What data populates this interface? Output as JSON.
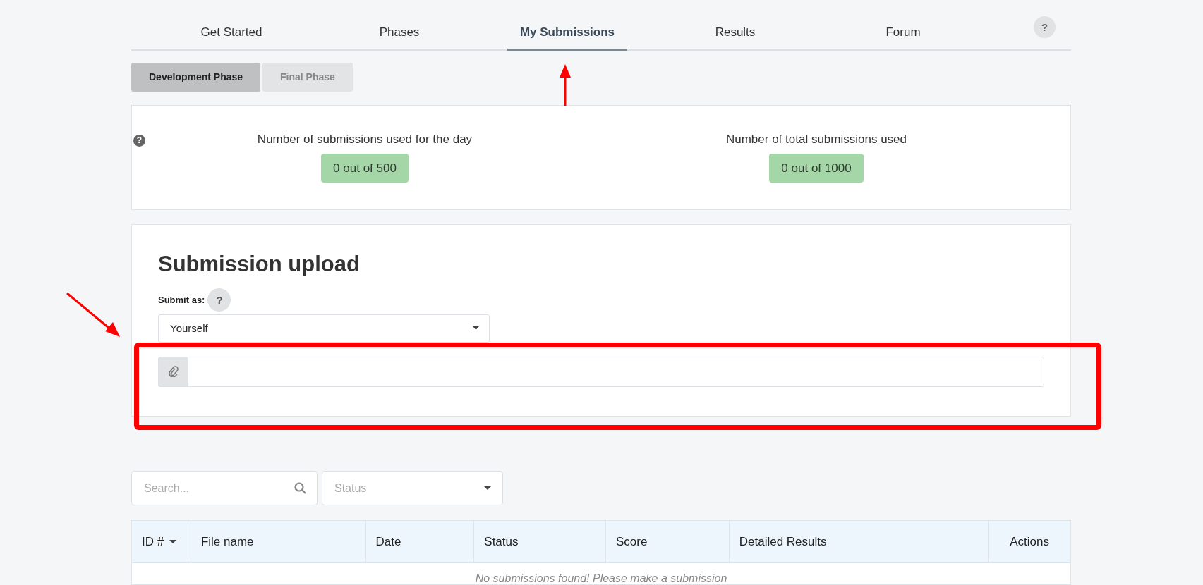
{
  "tabs": [
    {
      "label": "Get Started",
      "selected": false
    },
    {
      "label": "Phases",
      "selected": false
    },
    {
      "label": "My Submissions",
      "selected": true
    },
    {
      "label": "Results",
      "selected": false
    },
    {
      "label": "Forum",
      "selected": false
    }
  ],
  "help_button": "?",
  "phases": [
    {
      "label": "Development Phase",
      "selected": true
    },
    {
      "label": "Final Phase",
      "selected": false
    }
  ],
  "stats_help": "?",
  "stats": [
    {
      "label": "Number of submissions used for the day",
      "value": "0 out of 500"
    },
    {
      "label": "Number of total submissions used",
      "value": "0 out of 1000"
    }
  ],
  "upload": {
    "title": "Submission upload",
    "submit_as_label": "Submit as:",
    "help": "?",
    "submit_as": "Yourself"
  },
  "filters": {
    "search_placeholder": "Search...",
    "status_placeholder": "Status"
  },
  "table": {
    "columns": [
      {
        "label": "ID #",
        "sorted": true
      },
      {
        "label": "File name",
        "sorted": false
      },
      {
        "label": "Date",
        "sorted": false
      },
      {
        "label": "Status",
        "sorted": false
      },
      {
        "label": "Score",
        "sorted": false
      },
      {
        "label": "Detailed Results",
        "sorted": false
      },
      {
        "label": "Actions",
        "sorted": false
      }
    ],
    "empty_message": "No submissions found! Please make a submission"
  }
}
